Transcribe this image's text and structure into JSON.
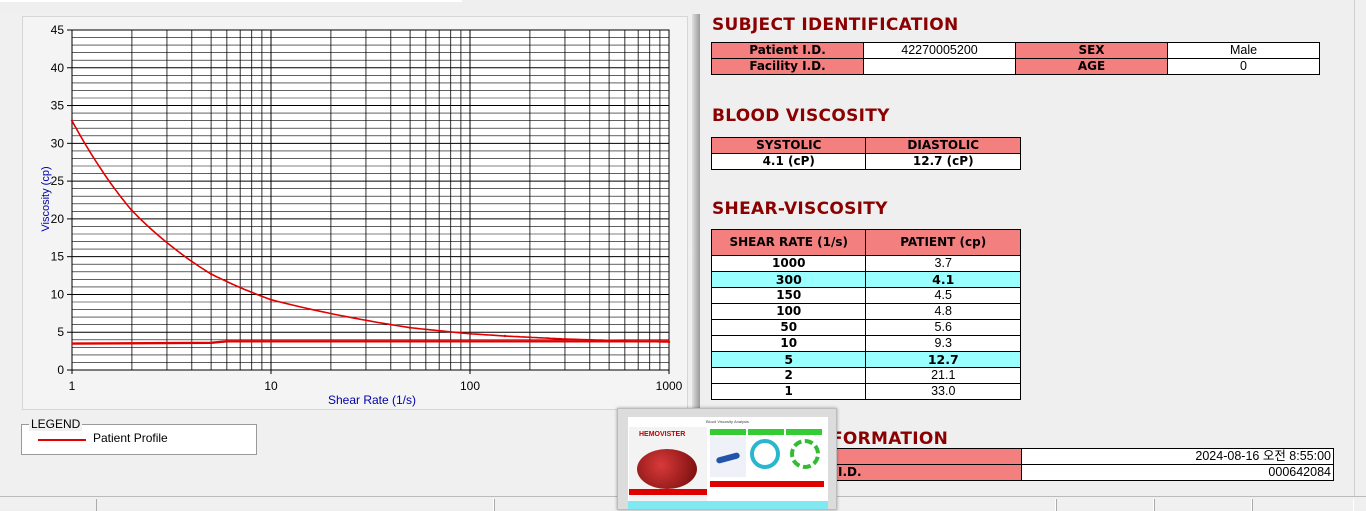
{
  "chart_data": {
    "type": "line",
    "xlabel": "Shear Rate (1/s)",
    "ylabel": "Viscosity (cp)",
    "xscale": "log",
    "xlim": [
      1,
      1000
    ],
    "ylim": [
      0,
      45
    ],
    "grid": true,
    "x_ticks": [
      "1",
      "10",
      "100",
      "1000"
    ],
    "y_ticks": [
      "0",
      "5",
      "10",
      "15",
      "20",
      "25",
      "30",
      "35",
      "40",
      "45"
    ],
    "series": [
      {
        "name": "Patient Profile",
        "color": "#e00000",
        "x": [
          1,
          2,
          5,
          10,
          50,
          100,
          150,
          300,
          1000
        ],
        "y": [
          33.0,
          21.1,
          12.7,
          9.3,
          5.6,
          4.8,
          4.5,
          4.1,
          3.7
        ]
      },
      {
        "color": "#e00000",
        "x": [
          1,
          5,
          6,
          10,
          100,
          1000
        ],
        "y": [
          3.5,
          3.6,
          3.8,
          3.8,
          3.8,
          3.8
        ]
      }
    ],
    "legend": {
      "title": "LEGEND",
      "placement": "bottom-left",
      "entries": [
        "Patient Profile"
      ]
    }
  },
  "subject": {
    "title": "SUBJECT IDENTIFICATION",
    "patient_id_label": "Patient I.D.",
    "patient_id": "42270005200",
    "sex_label": "SEX",
    "sex": "Male",
    "facility_id_label": "Facility I.D.",
    "facility_id": "",
    "age_label": "AGE",
    "age": "0"
  },
  "blood": {
    "title": "BLOOD VISCOSITY",
    "systolic_label": "SYSTOLIC",
    "diastolic_label": "DIASTOLIC",
    "systolic": "4.1 (cP)",
    "diastolic": "12.7 (cP)"
  },
  "shear": {
    "title": "SHEAR-VISCOSITY",
    "col_rate": "SHEAR RATE (1/s)",
    "col_patient": "PATIENT (cp)",
    "rows": [
      {
        "rate": "1000",
        "value": "3.7"
      },
      {
        "rate": "300",
        "value": "4.1"
      },
      {
        "rate": "150",
        "value": "4.5"
      },
      {
        "rate": "100",
        "value": "4.8"
      },
      {
        "rate": "50",
        "value": "5.6"
      },
      {
        "rate": "10",
        "value": "9.3"
      },
      {
        "rate": "5",
        "value": "12.7"
      },
      {
        "rate": "2",
        "value": "21.1"
      },
      {
        "rate": "1",
        "value": "33.0"
      }
    ]
  },
  "info": {
    "title_visible": "FORMATION",
    "row2_label_visible": "I.D.",
    "datetime": "2024-08-16   오전 8:55:00",
    "test_id": "000642084"
  },
  "thumbnail": {
    "logo_text": "HEMOVISTER",
    "caption": "Blood Viscosity Analysis"
  },
  "colors": {
    "header_red": "#f47f7f",
    "title_red": "#8b0000",
    "highlight_cyan": "#99ffff",
    "curve_red": "#e00000"
  }
}
